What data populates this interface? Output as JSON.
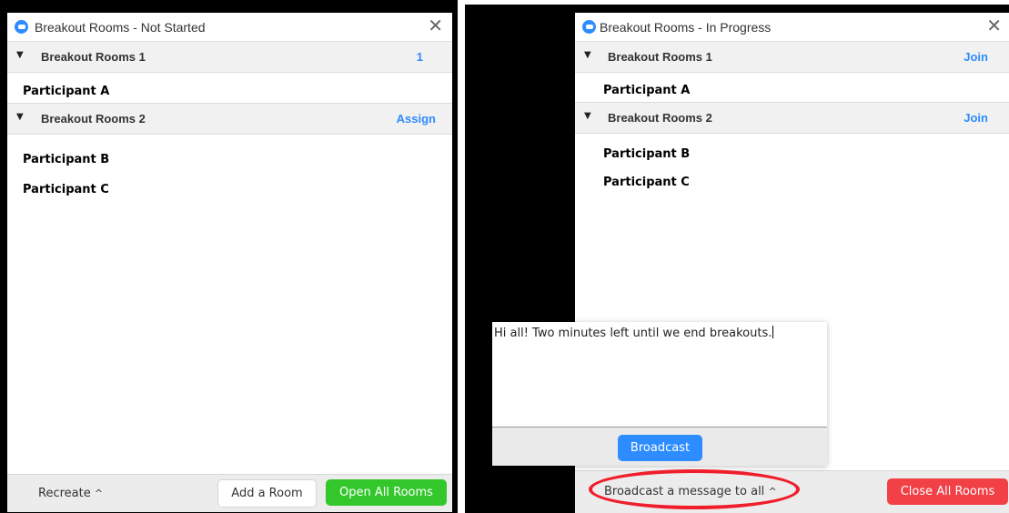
{
  "left_window": {
    "title": "Breakout Rooms - Not Started",
    "close_glyph": "✕",
    "rooms": [
      {
        "caret": "▼",
        "name": "Breakout Rooms 1",
        "action": "1",
        "participants": [
          "Participant A"
        ]
      },
      {
        "caret": "▼",
        "name": "Breakout Rooms 2",
        "action": "Assign",
        "participants": [
          "Participant B",
          "Participant C"
        ]
      }
    ],
    "footer": {
      "recreate_label": "Recreate",
      "chevron_glyph": "^",
      "add_room_label": "Add a Room",
      "open_all_label": "Open All Rooms"
    }
  },
  "right_window": {
    "title": "Breakout Rooms - In Progress",
    "close_glyph": "✕",
    "rooms": [
      {
        "caret": "▼",
        "name": "Breakout Rooms 1",
        "action": "Join",
        "participants": [
          "Participant A"
        ]
      },
      {
        "caret": "▼",
        "name": "Breakout Rooms 2",
        "action": "Join",
        "participants": [
          "Participant B",
          "Participant C"
        ]
      }
    ],
    "broadcast_popup": {
      "message": "Hi all!  Two minutes left until we end breakouts.",
      "button_label": "Broadcast"
    },
    "footer": {
      "broadcast_link_label": "Broadcast a message to all",
      "chevron_glyph": "^",
      "close_all_label": "Close All Rooms"
    }
  },
  "colors": {
    "accent_blue": "#2d8cff",
    "green": "#34c72c",
    "red": "#f24047",
    "highlight_ellipse": "#f01e2c"
  },
  "icons": {
    "app": "zoom-logo-icon",
    "close": "close-icon",
    "caret": "caret-down-icon",
    "chevron": "chevron-up-icon"
  }
}
